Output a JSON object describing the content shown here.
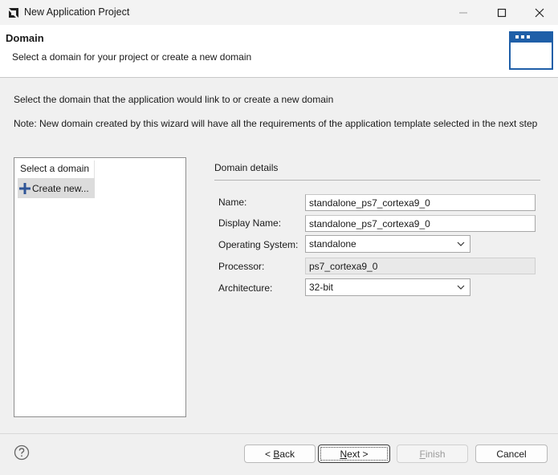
{
  "window": {
    "title": "New Application Project"
  },
  "header": {
    "title": "Domain",
    "subtitle": "Select a domain for your project or create a new domain"
  },
  "body": {
    "instruction": "Select the domain that the application would link to or create a new domain",
    "note": "Note: New domain created by this wizard will have all the requirements of the application template selected in the next step"
  },
  "domain_list": {
    "header": "Select a domain",
    "items": [
      {
        "label": "Create new...",
        "icon": "plus-icon"
      }
    ]
  },
  "details": {
    "title": "Domain details",
    "name_label": "Name:",
    "name_value": "standalone_ps7_cortexa9_0",
    "display_name_label": "Display Name:",
    "display_name_value": "standalone_ps7_cortexa9_0",
    "os_label": "Operating System:",
    "os_value": "standalone",
    "processor_label": "Processor:",
    "processor_value": "ps7_cortexa9_0",
    "arch_label": "Architecture:",
    "arch_value": "32-bit"
  },
  "footer": {
    "back_prefix": "< ",
    "back_mnemonic": "B",
    "back_rest": "ack",
    "next_mnemonic": "N",
    "next_rest": "ext >",
    "finish_mnemonic": "F",
    "finish_rest": "inish",
    "cancel": "Cancel"
  },
  "colors": {
    "accent": "#1f5fa8",
    "plus": "#2f5597"
  }
}
